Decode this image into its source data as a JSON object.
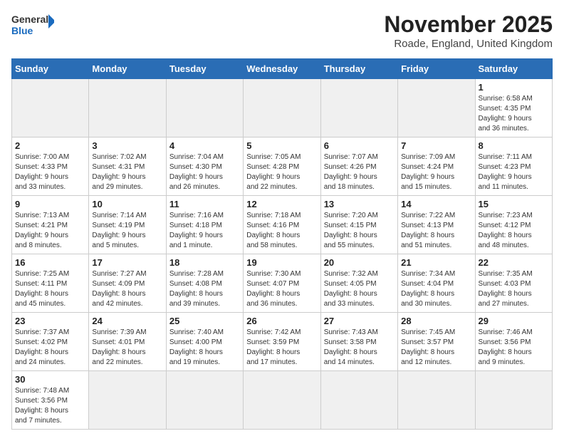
{
  "logo": {
    "text_general": "General",
    "text_blue": "Blue"
  },
  "title": "November 2025",
  "subtitle": "Roade, England, United Kingdom",
  "headers": [
    "Sunday",
    "Monday",
    "Tuesday",
    "Wednesday",
    "Thursday",
    "Friday",
    "Saturday"
  ],
  "days": [
    {
      "num": "",
      "info": "",
      "empty": true
    },
    {
      "num": "",
      "info": "",
      "empty": true
    },
    {
      "num": "",
      "info": "",
      "empty": true
    },
    {
      "num": "",
      "info": "",
      "empty": true
    },
    {
      "num": "",
      "info": "",
      "empty": true
    },
    {
      "num": "",
      "info": "",
      "empty": true
    },
    {
      "num": "1",
      "info": "Sunrise: 6:58 AM\nSunset: 4:35 PM\nDaylight: 9 hours\nand 36 minutes."
    }
  ],
  "week2": [
    {
      "num": "2",
      "info": "Sunrise: 7:00 AM\nSunset: 4:33 PM\nDaylight: 9 hours\nand 33 minutes."
    },
    {
      "num": "3",
      "info": "Sunrise: 7:02 AM\nSunset: 4:31 PM\nDaylight: 9 hours\nand 29 minutes."
    },
    {
      "num": "4",
      "info": "Sunrise: 7:04 AM\nSunset: 4:30 PM\nDaylight: 9 hours\nand 26 minutes."
    },
    {
      "num": "5",
      "info": "Sunrise: 7:05 AM\nSunset: 4:28 PM\nDaylight: 9 hours\nand 22 minutes."
    },
    {
      "num": "6",
      "info": "Sunrise: 7:07 AM\nSunset: 4:26 PM\nDaylight: 9 hours\nand 18 minutes."
    },
    {
      "num": "7",
      "info": "Sunrise: 7:09 AM\nSunset: 4:24 PM\nDaylight: 9 hours\nand 15 minutes."
    },
    {
      "num": "8",
      "info": "Sunrise: 7:11 AM\nSunset: 4:23 PM\nDaylight: 9 hours\nand 11 minutes."
    }
  ],
  "week3": [
    {
      "num": "9",
      "info": "Sunrise: 7:13 AM\nSunset: 4:21 PM\nDaylight: 9 hours\nand 8 minutes."
    },
    {
      "num": "10",
      "info": "Sunrise: 7:14 AM\nSunset: 4:19 PM\nDaylight: 9 hours\nand 5 minutes."
    },
    {
      "num": "11",
      "info": "Sunrise: 7:16 AM\nSunset: 4:18 PM\nDaylight: 9 hours\nand 1 minute."
    },
    {
      "num": "12",
      "info": "Sunrise: 7:18 AM\nSunset: 4:16 PM\nDaylight: 8 hours\nand 58 minutes."
    },
    {
      "num": "13",
      "info": "Sunrise: 7:20 AM\nSunset: 4:15 PM\nDaylight: 8 hours\nand 55 minutes."
    },
    {
      "num": "14",
      "info": "Sunrise: 7:22 AM\nSunset: 4:13 PM\nDaylight: 8 hours\nand 51 minutes."
    },
    {
      "num": "15",
      "info": "Sunrise: 7:23 AM\nSunset: 4:12 PM\nDaylight: 8 hours\nand 48 minutes."
    }
  ],
  "week4": [
    {
      "num": "16",
      "info": "Sunrise: 7:25 AM\nSunset: 4:11 PM\nDaylight: 8 hours\nand 45 minutes."
    },
    {
      "num": "17",
      "info": "Sunrise: 7:27 AM\nSunset: 4:09 PM\nDaylight: 8 hours\nand 42 minutes."
    },
    {
      "num": "18",
      "info": "Sunrise: 7:28 AM\nSunset: 4:08 PM\nDaylight: 8 hours\nand 39 minutes."
    },
    {
      "num": "19",
      "info": "Sunrise: 7:30 AM\nSunset: 4:07 PM\nDaylight: 8 hours\nand 36 minutes."
    },
    {
      "num": "20",
      "info": "Sunrise: 7:32 AM\nSunset: 4:05 PM\nDaylight: 8 hours\nand 33 minutes."
    },
    {
      "num": "21",
      "info": "Sunrise: 7:34 AM\nSunset: 4:04 PM\nDaylight: 8 hours\nand 30 minutes."
    },
    {
      "num": "22",
      "info": "Sunrise: 7:35 AM\nSunset: 4:03 PM\nDaylight: 8 hours\nand 27 minutes."
    }
  ],
  "week5": [
    {
      "num": "23",
      "info": "Sunrise: 7:37 AM\nSunset: 4:02 PM\nDaylight: 8 hours\nand 24 minutes."
    },
    {
      "num": "24",
      "info": "Sunrise: 7:39 AM\nSunset: 4:01 PM\nDaylight: 8 hours\nand 22 minutes."
    },
    {
      "num": "25",
      "info": "Sunrise: 7:40 AM\nSunset: 4:00 PM\nDaylight: 8 hours\nand 19 minutes."
    },
    {
      "num": "26",
      "info": "Sunrise: 7:42 AM\nSunset: 3:59 PM\nDaylight: 8 hours\nand 17 minutes."
    },
    {
      "num": "27",
      "info": "Sunrise: 7:43 AM\nSunset: 3:58 PM\nDaylight: 8 hours\nand 14 minutes."
    },
    {
      "num": "28",
      "info": "Sunrise: 7:45 AM\nSunset: 3:57 PM\nDaylight: 8 hours\nand 12 minutes."
    },
    {
      "num": "29",
      "info": "Sunrise: 7:46 AM\nSunset: 3:56 PM\nDaylight: 8 hours\nand 9 minutes."
    }
  ],
  "week6": [
    {
      "num": "30",
      "info": "Sunrise: 7:48 AM\nSunset: 3:56 PM\nDaylight: 8 hours\nand 7 minutes."
    },
    {
      "num": "",
      "info": "",
      "empty": true
    },
    {
      "num": "",
      "info": "",
      "empty": true
    },
    {
      "num": "",
      "info": "",
      "empty": true
    },
    {
      "num": "",
      "info": "",
      "empty": true
    },
    {
      "num": "",
      "info": "",
      "empty": true
    },
    {
      "num": "",
      "info": "",
      "empty": true
    }
  ]
}
